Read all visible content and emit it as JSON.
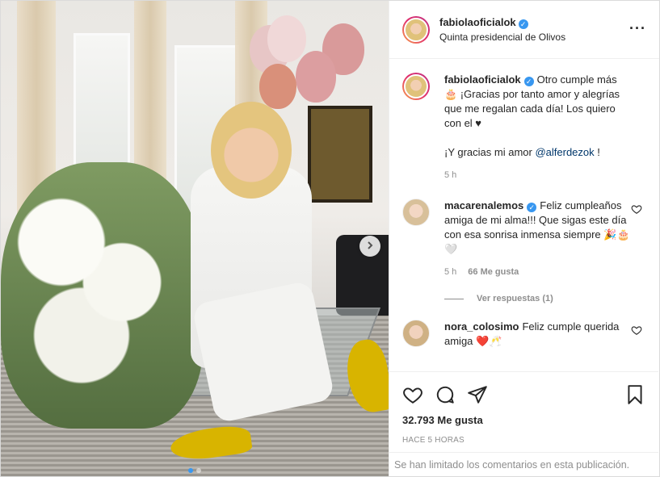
{
  "header": {
    "username": "fabiolaoficialok",
    "location": "Quinta presidencial de Olivos",
    "more_icon": "more-horizontal-icon",
    "verified_icon": "verified-badge-icon"
  },
  "caption": {
    "username": "fabiolaoficialok",
    "text_1": "Otro cumple más 🎂 ¡Gracias por tanto amor y alegrías que me regalan cada día! Los quiero con el ♥",
    "text_2a": "¡Y gracias mi amor ",
    "mention": "@alferdezok",
    "text_2b": " !",
    "time": "5 h"
  },
  "comments": [
    {
      "username": "macarenalemos",
      "verified": true,
      "text": "Feliz cumpleaños amiga de mi alma!!! Que sigas este día con esa sonrisa inmensa siempre 🎉🎂🤍",
      "time": "5 h",
      "likes": "66 Me gusta",
      "replies": "Ver respuestas (1)"
    },
    {
      "username": "nora_colosimo",
      "verified": false,
      "text": "Feliz cumple querida amiga ❤️🥂"
    }
  ],
  "actions": {
    "like_icon": "heart-icon",
    "comment_icon": "comment-icon",
    "share_icon": "share-icon",
    "save_icon": "bookmark-icon",
    "likes": "32.793 Me gusta",
    "posted_ago": "HACE 5 HORAS"
  },
  "footer": {
    "limited_notice": "Se han limitado los comentarios en esta publicación."
  },
  "carousel": {
    "next_icon": "chevron-right-icon",
    "slides": 2,
    "active_slide": 1
  },
  "colors": {
    "accent": "#3897f0",
    "text": "#262626",
    "secondary": "#8e8e8e",
    "heart": "#ed4956"
  }
}
